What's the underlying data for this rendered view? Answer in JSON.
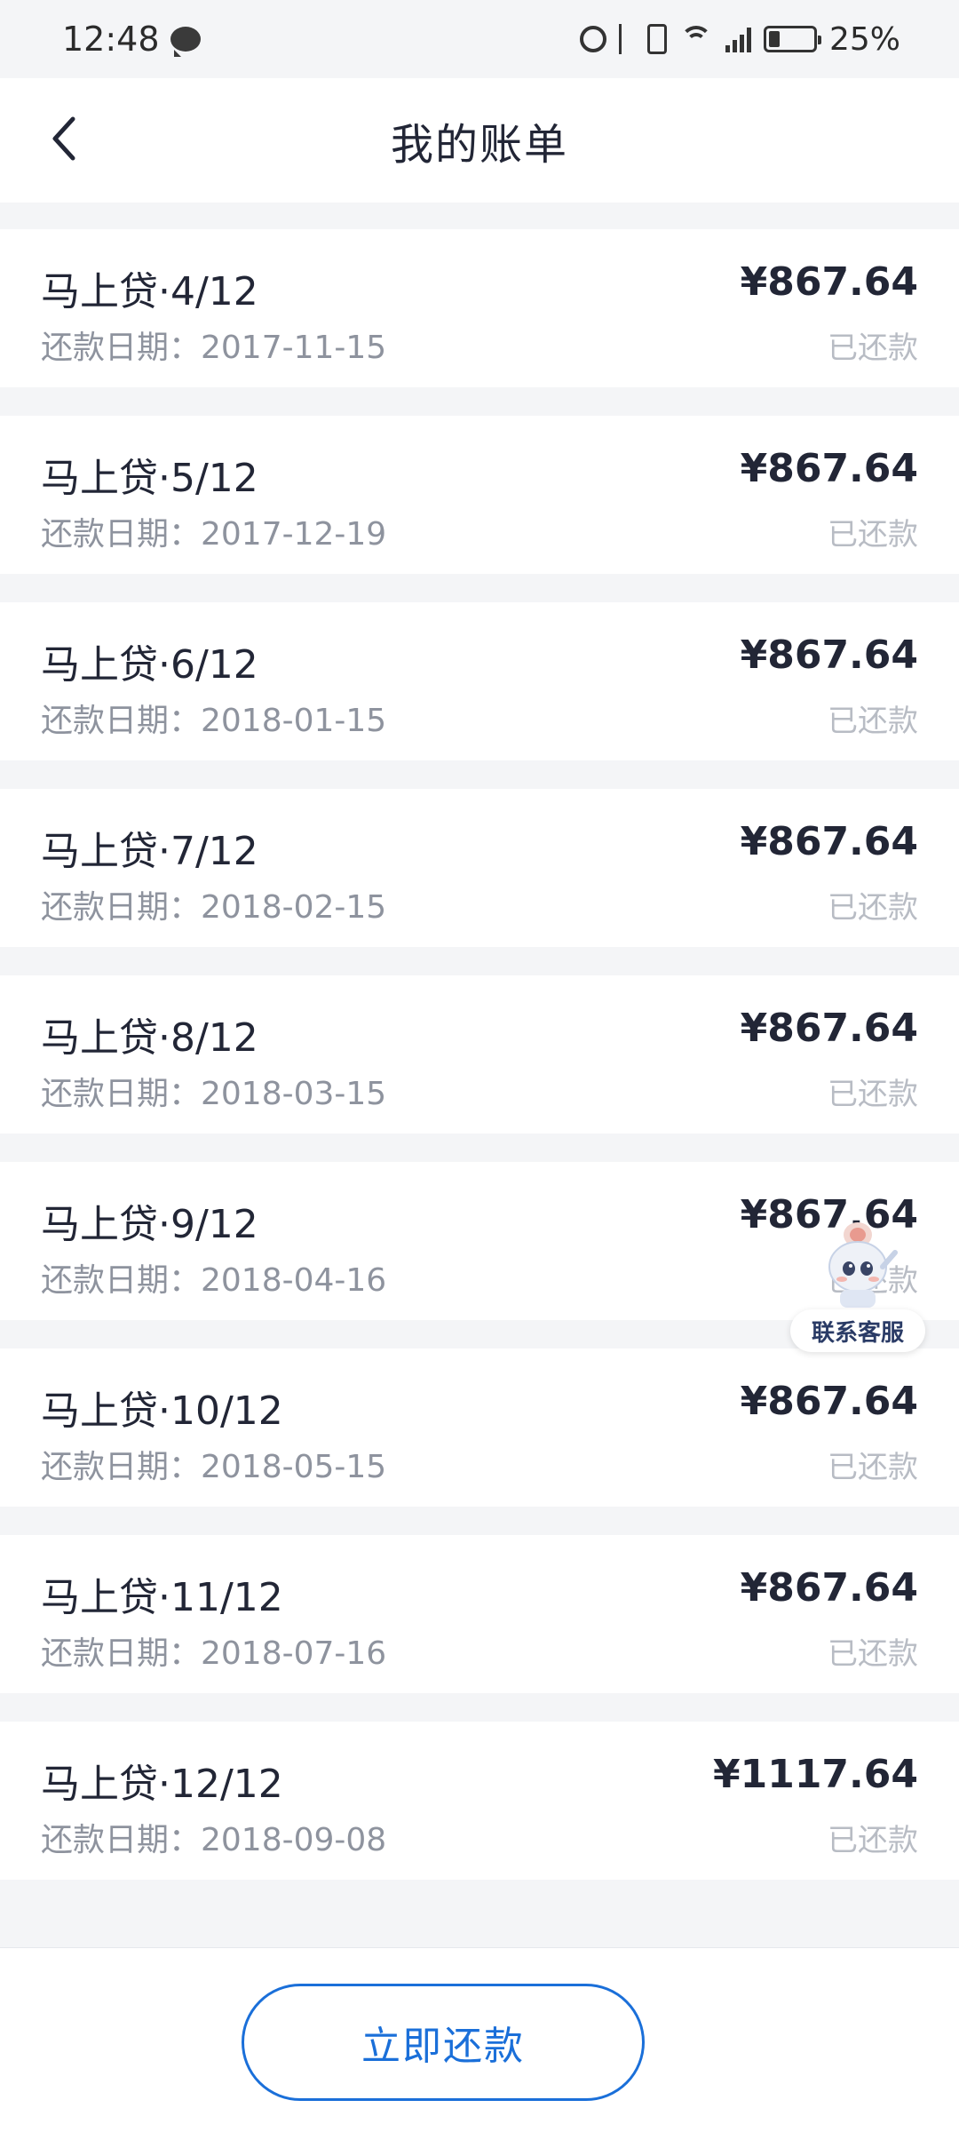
{
  "status_bar": {
    "time": "12:48",
    "battery": "25%",
    "icons": [
      "chat-icon",
      "alarm-icon",
      "bluetooth-icon",
      "vibrate-icon",
      "wifi-icon",
      "signal-4g-icon",
      "battery-icon"
    ]
  },
  "header": {
    "title": "我的账单",
    "back_icon": "chevron-left-icon"
  },
  "bills": [
    {
      "name": "马上贷·4/12",
      "date": "还款日期：2017-11-15",
      "amount": "¥867.64",
      "status": "已还款"
    },
    {
      "name": "马上贷·5/12",
      "date": "还款日期：2017-12-19",
      "amount": "¥867.64",
      "status": "已还款"
    },
    {
      "name": "马上贷·6/12",
      "date": "还款日期：2018-01-15",
      "amount": "¥867.64",
      "status": "已还款"
    },
    {
      "name": "马上贷·7/12",
      "date": "还款日期：2018-02-15",
      "amount": "¥867.64",
      "status": "已还款"
    },
    {
      "name": "马上贷·8/12",
      "date": "还款日期：2018-03-15",
      "amount": "¥867.64",
      "status": "已还款"
    },
    {
      "name": "马上贷·9/12",
      "date": "还款日期：2018-04-16",
      "amount": "¥867.64",
      "status": "已还款"
    },
    {
      "name": "马上贷·10/12",
      "date": "还款日期：2018-05-15",
      "amount": "¥867.64",
      "status": "已还款"
    },
    {
      "name": "马上贷·11/12",
      "date": "还款日期：2018-07-16",
      "amount": "¥867.64",
      "status": "已还款"
    },
    {
      "name": "马上贷·12/12",
      "date": "还款日期：2018-09-08",
      "amount": "¥1117.64",
      "status": "已还款"
    }
  ],
  "customer_service": {
    "label": "联系客服"
  },
  "footer": {
    "pay_button": "立即还款"
  },
  "colors": {
    "accent": "#1a6fd9",
    "background": "#f4f5f7",
    "text_primary": "#222636",
    "text_secondary": "#8e939e",
    "status_muted": "#b8bcc4"
  }
}
